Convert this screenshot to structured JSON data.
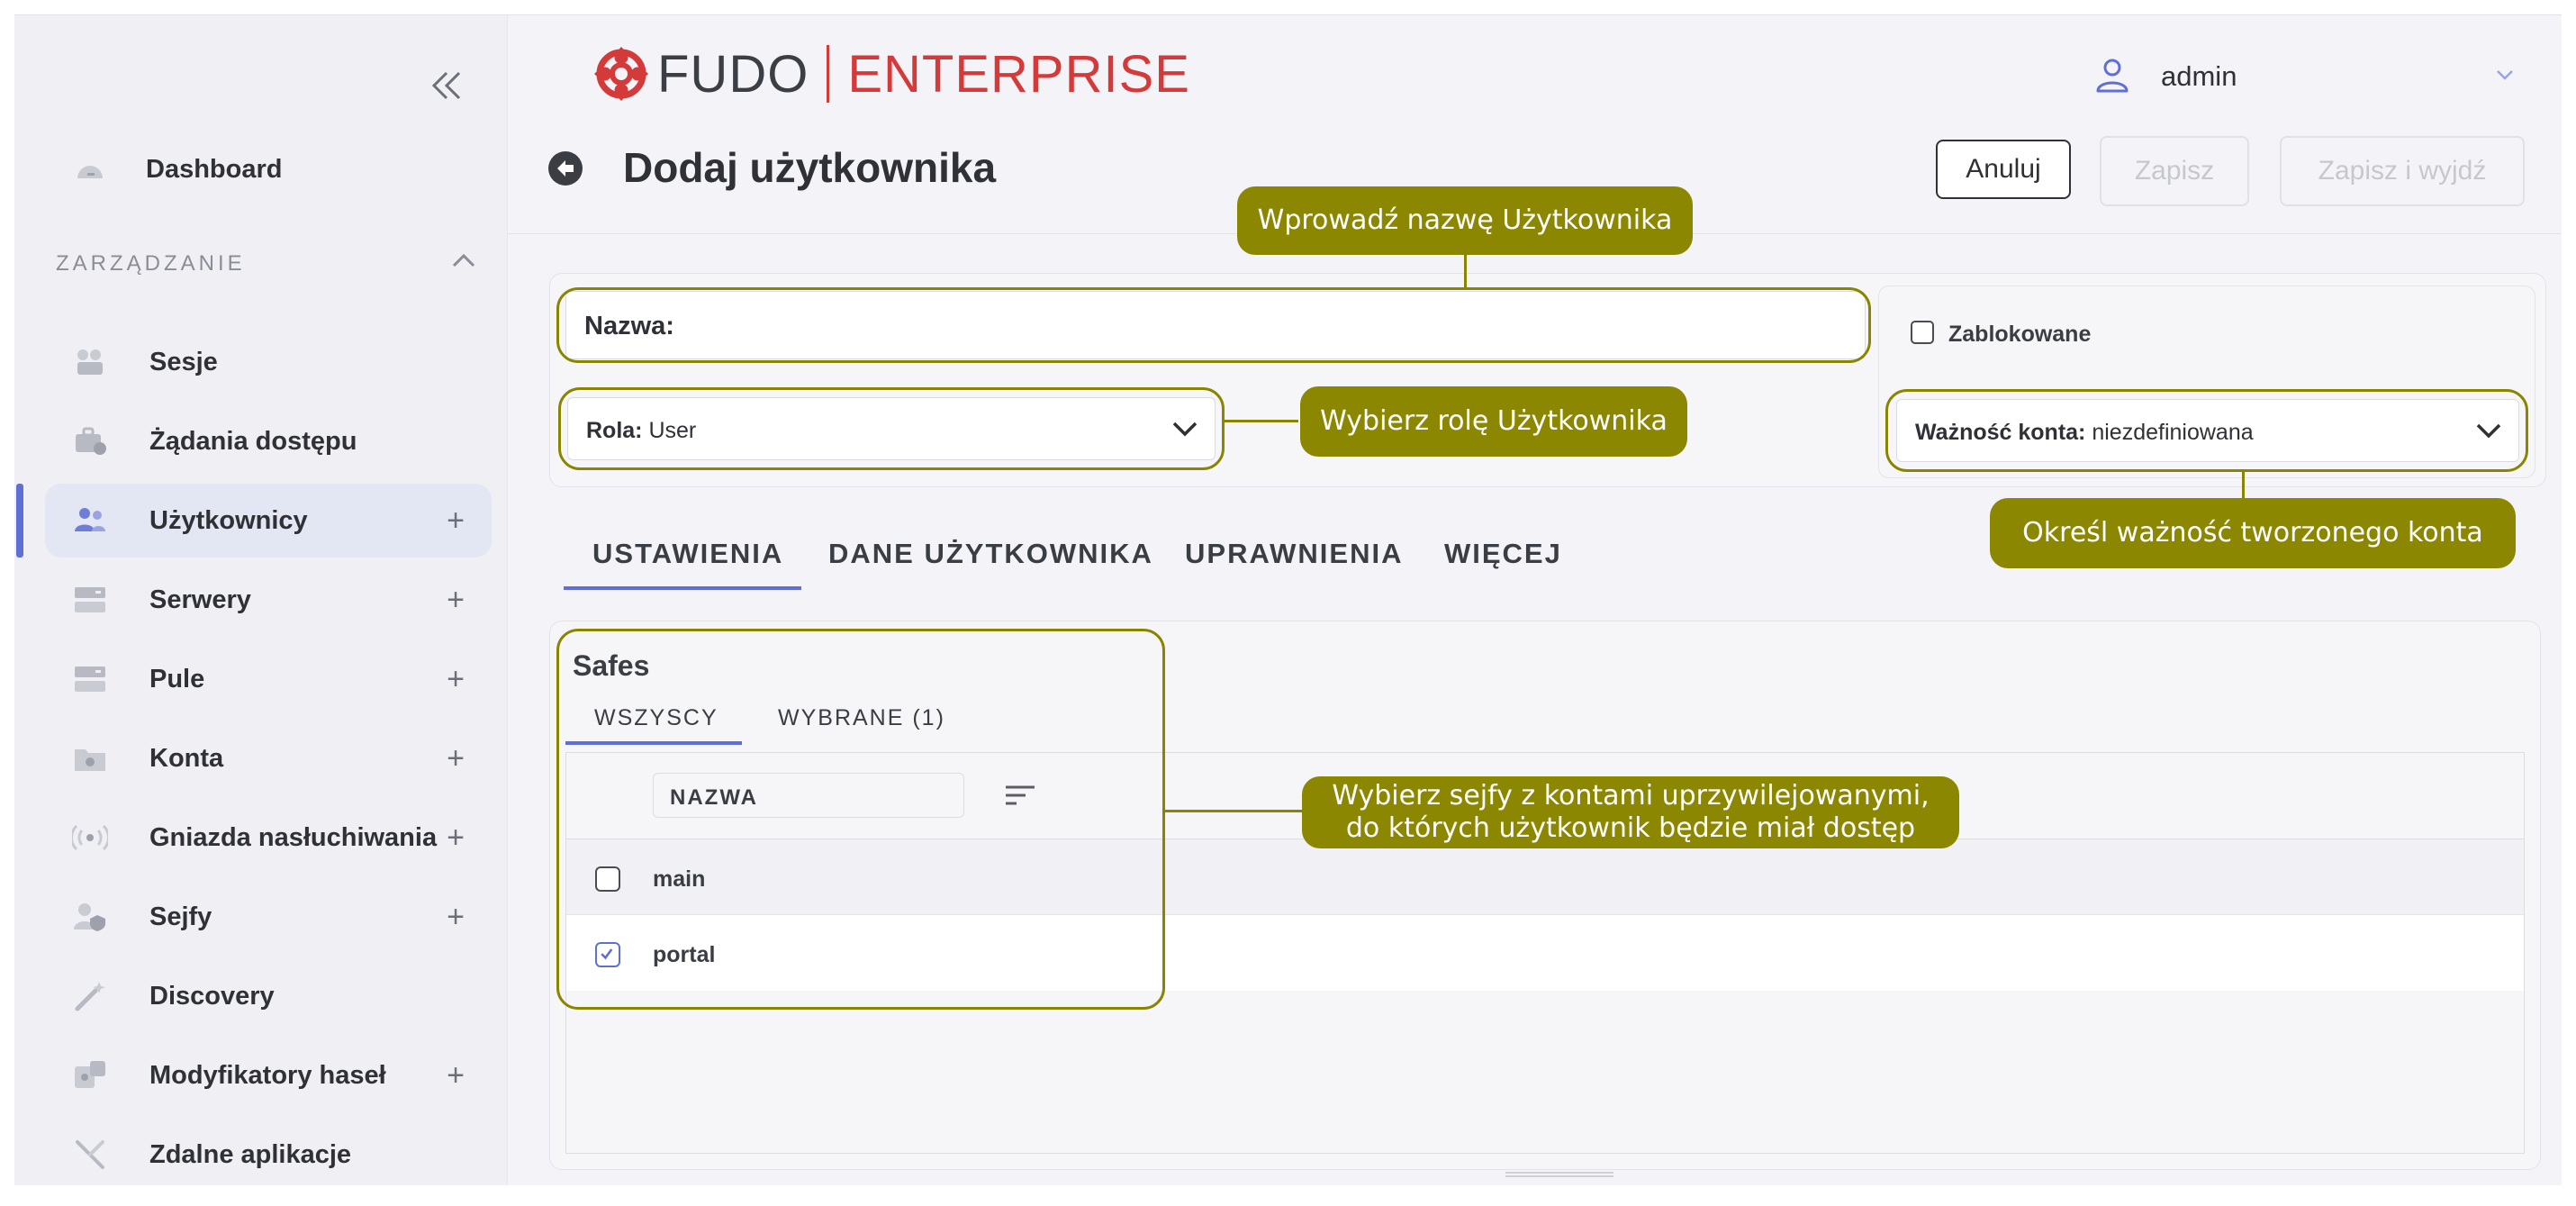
{
  "sidebar": {
    "section_label": "ZARZĄDZANIE",
    "items": [
      {
        "label": "Dashboard",
        "icon": "dashboard-icon"
      },
      {
        "label": "Sesje",
        "icon": "sessions-icon"
      },
      {
        "label": "Żądania dostępu",
        "icon": "access-requests-icon"
      },
      {
        "label": "Użytkownicy",
        "icon": "users-icon",
        "plus": "+"
      },
      {
        "label": "Serwery",
        "icon": "servers-icon",
        "plus": "+"
      },
      {
        "label": "Pule",
        "icon": "pools-icon",
        "plus": "+"
      },
      {
        "label": "Konta",
        "icon": "accounts-icon",
        "plus": "+"
      },
      {
        "label": "Gniazda nasłuchiwania",
        "icon": "listeners-icon",
        "plus": "+"
      },
      {
        "label": "Sejfy",
        "icon": "safes-icon",
        "plus": "+"
      },
      {
        "label": "Discovery",
        "icon": "discovery-icon"
      },
      {
        "label": "Modyfikatory haseł",
        "icon": "password-changers-icon",
        "plus": "+"
      },
      {
        "label": "Zdalne aplikacje",
        "icon": "remote-apps-icon"
      }
    ],
    "active_index": 3
  },
  "header": {
    "logo_fudo": "FUDO",
    "logo_enterprise": "ENTERPRISE",
    "user_name": "admin",
    "page_title": "Dodaj użytkownika",
    "cancel_label": "Anuluj",
    "save_label": "Zapisz",
    "save_exit_label": "Zapisz i wyjdź"
  },
  "form": {
    "name_label": "Nazwa:",
    "name_value": "",
    "role_label": "Rola:",
    "role_value": "User",
    "blocked_label": "Zablokowane",
    "blocked_checked": false,
    "validity_label": "Ważność konta:",
    "validity_value": "niezdefiniowana"
  },
  "tabs": [
    {
      "label": "USTAWIENIA",
      "active": true
    },
    {
      "label": "DANE UŻYTKOWNIKA",
      "active": false
    },
    {
      "label": "UPRAWNIENIA",
      "active": false
    },
    {
      "label": "WIĘCEJ",
      "active": false
    }
  ],
  "safes": {
    "title": "Safes",
    "subtabs": [
      {
        "label": "WSZYSCY",
        "active": true
      },
      {
        "label": "WYBRANE (1)",
        "active": false
      }
    ],
    "column_header": "NAZWA",
    "rows": [
      {
        "name": "main",
        "checked": false
      },
      {
        "name": "portal",
        "checked": true
      }
    ]
  },
  "callouts": {
    "name": "Wprowadź nazwę Użytkownika",
    "role": "Wybierz rolę Użytkownika",
    "validity": "Określ ważność tworzonego konta",
    "safes_line1": "Wybierz sejfy z kontami uprzywilejowanymi,",
    "safes_line2": "do których użytkownik będzie miał dostęp"
  },
  "colors": {
    "accent": "#5f6fd6",
    "callout": "#8c8700",
    "brand_red": "#d43a3a"
  }
}
